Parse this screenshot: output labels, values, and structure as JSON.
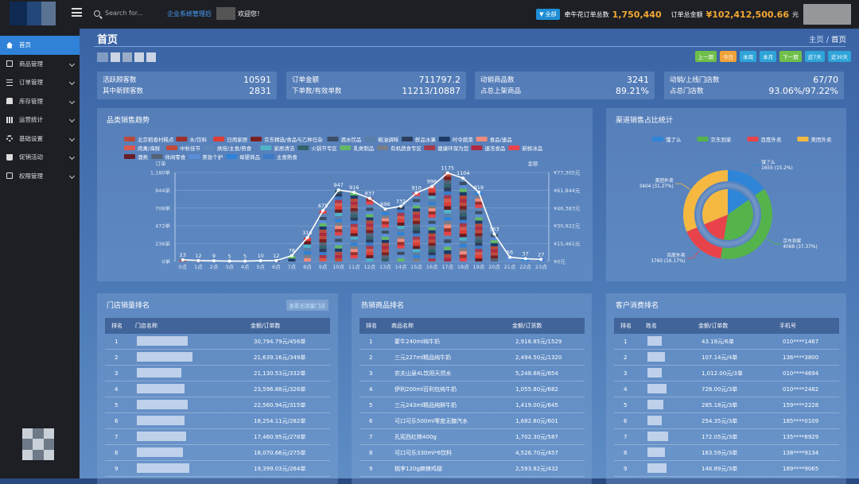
{
  "header": {
    "search_placeholder": "Search for...",
    "system_name": "企业系统管理后",
    "welcome": "欢迎您！",
    "badge": "▼ 全部",
    "stat1_label": "牵牛花订单总数",
    "stat1_value": "1,750,440",
    "stat2_label": "订单总金额",
    "stat2_value": "¥102,412,500.66",
    "stat2_unit": "元"
  },
  "sidebar": {
    "items": [
      {
        "label": "首页",
        "icon": "home-icon"
      },
      {
        "label": "商品管理",
        "icon": "box-icon"
      },
      {
        "label": "订单管理",
        "icon": "list-icon"
      },
      {
        "label": "库存管理",
        "icon": "warehouse-icon"
      },
      {
        "label": "运营统计",
        "icon": "bar-chart-icon"
      },
      {
        "label": "基础设置",
        "icon": "gear-icon"
      },
      {
        "label": "促销活动",
        "icon": "bag-icon"
      },
      {
        "label": "权限管理",
        "icon": "lock-icon"
      }
    ]
  },
  "page": {
    "title": "首页",
    "breadcrumb_home": "主页",
    "breadcrumb_sep": "/",
    "breadcrumb_current": "首页"
  },
  "ranges": [
    {
      "label": "上一期",
      "color": "#6fbf4a"
    },
    {
      "label": "今日",
      "color": "#f0a23a"
    },
    {
      "label": "本周",
      "color": "#2ea4d8"
    },
    {
      "label": "本月",
      "color": "#2ea4d8"
    },
    {
      "label": "下一期",
      "color": "#6fbf4a"
    },
    {
      "label": "近7天",
      "color": "#2ea4d8"
    },
    {
      "label": "近30天",
      "color": "#2ea4d8"
    }
  ],
  "kpis": [
    {
      "l1": "活跃顾客数",
      "v1": "10591",
      "l2": "其中新顾客数",
      "v2": "2831"
    },
    {
      "l1": "订单金额",
      "v1": "711797.2",
      "l2": "下单数/有效单数",
      "v2": "11213/10887"
    },
    {
      "l1": "动销商品数",
      "v1": "3241",
      "l2": "占总上架商品",
      "v2": "89.21%"
    },
    {
      "l1": "动销/上线门店数",
      "v1": "67/70",
      "l2": "占总门店数",
      "v2": "93.06%/97.22%"
    }
  ],
  "trend": {
    "title": "品类销售趋势",
    "left_axis_label": "订单",
    "right_axis_label": "金额"
  },
  "chart_data": [
    {
      "type": "bar",
      "title": "品类销售趋势",
      "categories": [
        "0点",
        "1点",
        "2点",
        "3点",
        "4点",
        "5点",
        "6点",
        "7点",
        "8点",
        "9点",
        "10点",
        "11点",
        "12点",
        "13点",
        "14点",
        "15点",
        "16点",
        "17点",
        "18点",
        "19点",
        "20点",
        "21点",
        "22点",
        "23点"
      ],
      "legend": [
        {
          "name": "北京稻香村糕点",
          "color": "#b84a3c"
        },
        {
          "name": "水/饮料",
          "color": "#9c2f2a"
        },
        {
          "name": "日用家居",
          "color": "#e03b33"
        },
        {
          "name": "京东精选/食品与乙种日杂",
          "color": "#7a2020"
        },
        {
          "name": "酒水饮品",
          "color": "#3c4e66"
        },
        {
          "name": "粮油调味",
          "color": "#5a7fa8"
        },
        {
          "name": "鲜品水果",
          "color": "#2c3e5c"
        },
        {
          "name": "时令蔬菜",
          "color": "#1d3a66"
        },
        {
          "name": "食品/速品",
          "color": "#f08b7c"
        },
        {
          "name": "肉禽/海鲜",
          "color": "#d9594f"
        },
        {
          "name": "中秋佳节",
          "color": "#c04a3a"
        },
        {
          "name": "烘焙/主食/熟食",
          "color": "#5d87b8"
        },
        {
          "name": "家居清洁",
          "color": "#4fb3c8"
        },
        {
          "name": "火锅节专区",
          "color": "#33626b"
        },
        {
          "name": "乳类制品",
          "color": "#64b867"
        },
        {
          "name": "有机蔬食专区",
          "color": "#7a7e86"
        },
        {
          "name": "健康环保为您",
          "color": "#a8394a"
        },
        {
          "name": "速冻食品",
          "color": "#b02a42"
        },
        {
          "name": "新鲜冰品",
          "color": "#e8434a"
        },
        {
          "name": "酒类",
          "color": "#6a1c24"
        },
        {
          "name": "休闲零食",
          "color": "#546274"
        },
        {
          "name": "美妆个护",
          "color": "#5b8ed8"
        },
        {
          "name": "母婴商品",
          "color": "#2e82d8"
        },
        {
          "name": "主食熟食",
          "color": "#3c7ac8"
        }
      ],
      "line_values": [
        23,
        12,
        9,
        5,
        5,
        10,
        12,
        78,
        316,
        675,
        947,
        916,
        837,
        696,
        732,
        910,
        996,
        1175,
        1104,
        919,
        363,
        56,
        37,
        27
      ],
      "bar_totals": [
        23,
        12,
        9,
        5,
        5,
        10,
        12,
        78,
        316,
        675,
        947,
        916,
        837,
        696,
        732,
        910,
        996,
        1175,
        1104,
        919,
        363,
        56,
        37,
        27
      ],
      "y_left_ticks": [
        "0单",
        "236单",
        "472单",
        "708单",
        "944单",
        "1,180单"
      ],
      "y_right_ticks": [
        "¥0元",
        "¥15,461元",
        "¥30,922元",
        "¥46,383元",
        "¥61,844元",
        "¥77,305元"
      ],
      "ylim": [
        0,
        1180
      ]
    },
    {
      "type": "pie",
      "title": "渠道销售占比统计",
      "legend": [
        {
          "name": "饿了么",
          "color": "#2f86d8"
        },
        {
          "name": "京东到家",
          "color": "#55b34c"
        },
        {
          "name": "百度外卖",
          "color": "#e8434a"
        },
        {
          "name": "美团外卖",
          "color": "#f5b942"
        }
      ],
      "slices": [
        {
          "name": "饿了么",
          "value": 1655,
          "pct": "15.2%",
          "label": "饿了么\n1655 (15.2%)"
        },
        {
          "name": "京东到家",
          "value": 4068,
          "pct": "37.37%",
          "label": "京东到家\n4068 (37.37%)"
        },
        {
          "name": "百度外卖",
          "value": 1760,
          "pct": "16.17%",
          "label": "百度外卖\n1760 (16.17%)"
        },
        {
          "name": "美团外卖",
          "value": 3404,
          "pct": "31.27%",
          "label": "美团外卖\n3404 (31.27%)"
        }
      ]
    }
  ],
  "store_rank": {
    "title": "门店销量排名",
    "button": "查看无销量门店",
    "headers": [
      "排名",
      "门店名称",
      "金额/订单数"
    ],
    "rows": [
      {
        "rank": "1",
        "value": "30,794.79元/456单"
      },
      {
        "rank": "2",
        "value": "21,639.16元/349单"
      },
      {
        "rank": "3",
        "value": "21,130.53元/332单"
      },
      {
        "rank": "4",
        "value": "23,596.88元/326单"
      },
      {
        "rank": "5",
        "value": "22,560.94元/315单"
      },
      {
        "rank": "6",
        "value": "18,254.11元/282单"
      },
      {
        "rank": "7",
        "value": "17,460.95元/278单"
      },
      {
        "rank": "8",
        "value": "18,070.66元/275单"
      },
      {
        "rank": "9",
        "value": "19,399.03元/264单"
      }
    ]
  },
  "product_rank": {
    "title": "热销商品排名",
    "headers": [
      "排名",
      "商品名称",
      "金额/订货数"
    ],
    "rows": [
      {
        "rank": "1",
        "name": "蒙牛240ml纯牛奶",
        "value": "2,916.85元/1529"
      },
      {
        "rank": "2",
        "name": "三元227ml精品纯牛奶",
        "value": "2,494.50元/1320"
      },
      {
        "rank": "3",
        "name": "农夫山泉4L饮用天然水",
        "value": "5,248.68元/854"
      },
      {
        "rank": "4",
        "name": "伊利200ml百利包纯牛奶",
        "value": "1,055.80元/682"
      },
      {
        "rank": "5",
        "name": "三元243ml精品纯鲜牛奶",
        "value": "1,419.00元/645"
      },
      {
        "rank": "6",
        "name": "可口可乐500ml零度无糖汽水",
        "value": "1,682.80元/601"
      },
      {
        "rank": "7",
        "name": "孔宪西红柿400g",
        "value": "1,702.30元/587"
      },
      {
        "rank": "8",
        "name": "可口可乐330ml*6饮料",
        "value": "4,526.70元/457"
      },
      {
        "rank": "9",
        "name": "桃李120g麻辣鸡翅",
        "value": "2,593.82元/432"
      }
    ]
  },
  "customer_rank": {
    "title": "客户消费排名",
    "headers": [
      "排名",
      "姓名",
      "金额/订单数",
      "手机号"
    ],
    "rows": [
      {
        "rank": "1",
        "value": "43.18元/6单",
        "phone": "010****1467"
      },
      {
        "rank": "2",
        "value": "107.14元/4单",
        "phone": "136****3800"
      },
      {
        "rank": "3",
        "value": "1,012.00元/3单",
        "phone": "010****4694"
      },
      {
        "rank": "4",
        "value": "728.00元/3单",
        "phone": "010****2482"
      },
      {
        "rank": "5",
        "value": "285.18元/3单",
        "phone": "159****2228"
      },
      {
        "rank": "6",
        "value": "254.35元/3单",
        "phone": "185****0109"
      },
      {
        "rank": "7",
        "value": "172.05元/3单",
        "phone": "135****6929"
      },
      {
        "rank": "8",
        "value": "163.59元/3单",
        "phone": "138****9134"
      },
      {
        "rank": "9",
        "value": "148.89元/3单",
        "phone": "189****9065"
      }
    ]
  }
}
